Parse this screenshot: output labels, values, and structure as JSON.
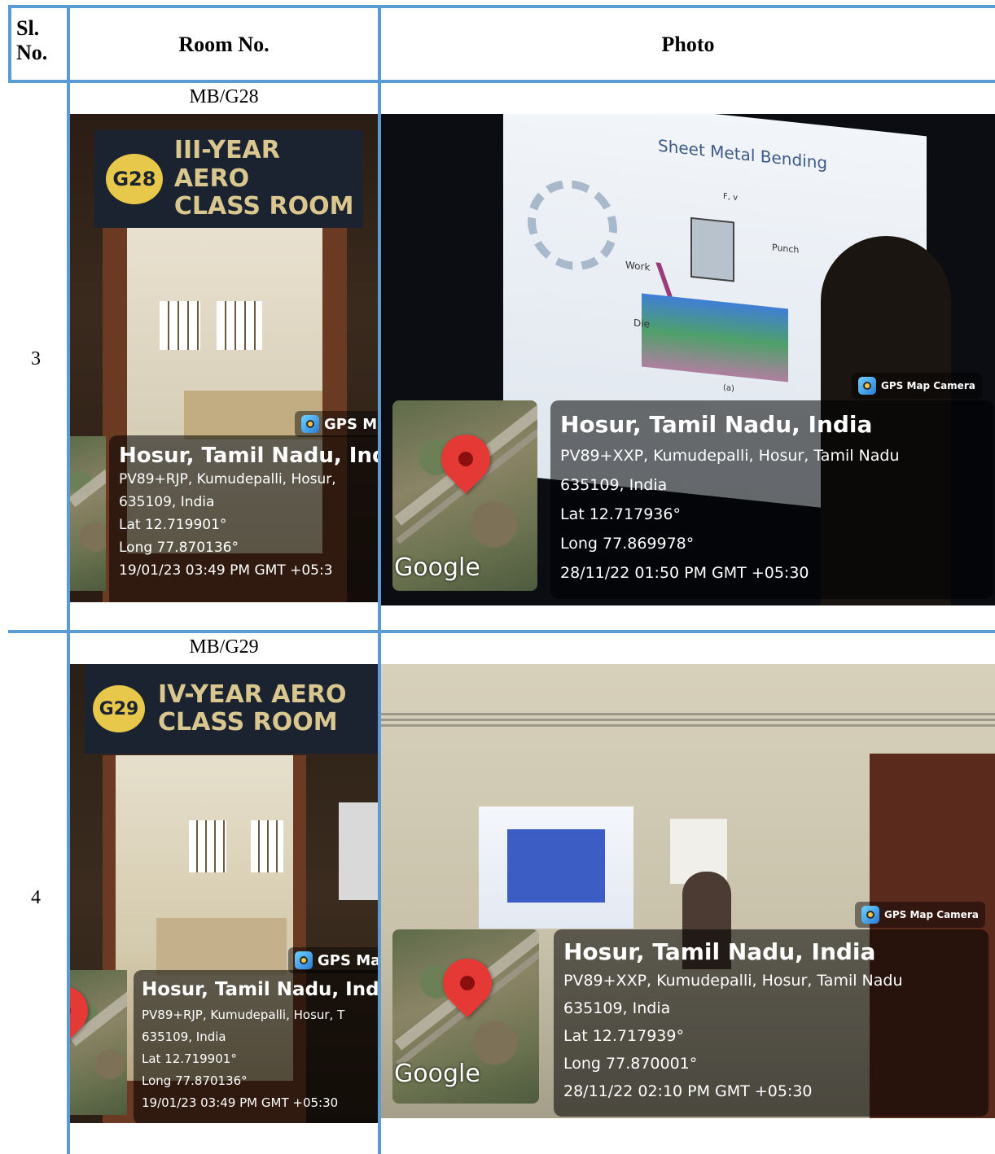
{
  "table": {
    "headers": {
      "sl_no": "Sl.\nNo.",
      "room_no": "Room No.",
      "photo": "Photo"
    },
    "rows": [
      {
        "sl_no": "3",
        "room_no": "MB/G28",
        "door_photo": {
          "sign_badge": "G28",
          "sign_line1": "III-YEAR AERO",
          "sign_line2": "CLASS ROOM",
          "tag": "GPS M",
          "place": "Hosur, Tamil Nadu, Ind",
          "address": "PV89+RJP, Kumudepalli, Hosur,",
          "pin": "635109, India",
          "lat": "Lat 12.719901°",
          "long": "Long 77.870136°",
          "datetime": "19/01/23 03:49 PM GMT +05:3"
        },
        "class_photo": {
          "slide_title": "Sheet Metal Bending",
          "slide_label_force": "F, v",
          "slide_label_punch": "Punch",
          "slide_label_work": "Work",
          "slide_label_die": "Die",
          "slide_label_a": "(a)",
          "tag": "GPS Map Camera",
          "google": "Google",
          "place": "Hosur, Tamil Nadu, India",
          "address": "PV89+XXP, Kumudepalli, Hosur, Tamil Nadu",
          "pin": "635109, India",
          "lat": "Lat 12.717936°",
          "long": "Long 77.869978°",
          "datetime": "28/11/22 01:50 PM GMT +05:30"
        }
      },
      {
        "sl_no": "4",
        "room_no": "MB/G29",
        "door_photo": {
          "sign_badge": "G29",
          "sign_line1": "IV-YEAR AERO",
          "sign_line2": "CLASS ROOM",
          "tag": "GPS Ma",
          "place": "Hosur, Tamil Nadu, India",
          "address": "PV89+RJP, Kumudepalli, Hosur, T",
          "pin": "635109, India",
          "lat": "Lat 12.719901°",
          "long": "Long 77.870136°",
          "datetime": "19/01/23 03:49 PM GMT +05:30"
        },
        "class_photo": {
          "tag": "GPS Map Camera",
          "google": "Google",
          "place": "Hosur, Tamil Nadu, India",
          "address": "PV89+XXP, Kumudepalli, Hosur, Tamil Nadu",
          "pin": "635109, India",
          "lat": "Lat 12.717939°",
          "long": "Long 77.870001°",
          "datetime": "28/11/22 02:10 PM GMT +05:30"
        }
      }
    ]
  },
  "colors": {
    "border": "#5b9bd5",
    "badge": "#e7c84a",
    "pin": "#e53935"
  },
  "icons": [
    "gps-camera-icon",
    "map-pin-icon"
  ]
}
